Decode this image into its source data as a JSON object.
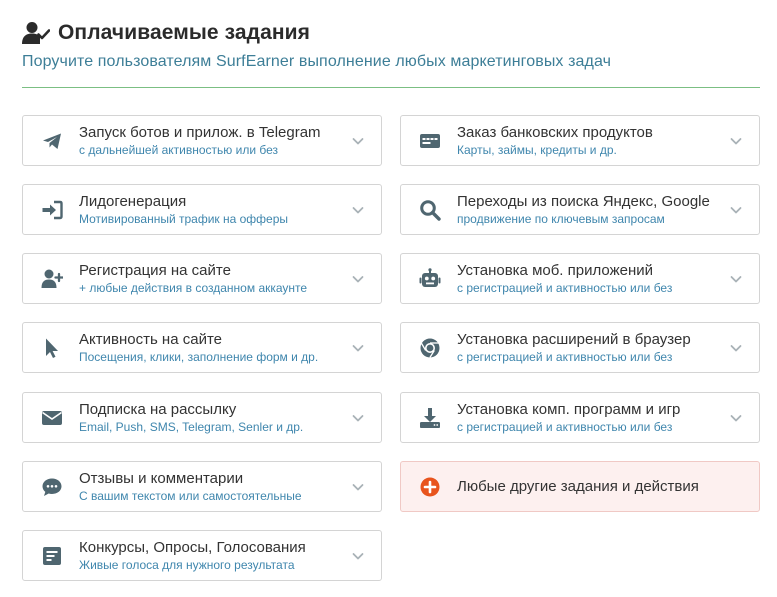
{
  "header": {
    "title": "Оплачиваемые задания",
    "subtitle": "Поручите пользователям SurfEarner выполнение любых маркетинговых задач",
    "icon": "user-check-icon"
  },
  "colors": {
    "accent": "#3f86ad",
    "divider": "#7bbf83",
    "icon_gray": "#4f6670",
    "special_bg": "#fdf0ef",
    "special_icon": "#e8541d"
  },
  "left_column": [
    {
      "title": "Запуск ботов и прилож. в Telegram",
      "subtitle": "с дальнейшей активностью или без",
      "icon": "telegram-icon"
    },
    {
      "title": "Лидогенерация",
      "subtitle": "Мотивированный трафик на офферы",
      "icon": "sign-in-icon"
    },
    {
      "title": "Регистрация на сайте",
      "subtitle": "+ любые действия в созданном аккаунте",
      "icon": "user-plus-icon"
    },
    {
      "title": "Активность на сайте",
      "subtitle": "Посещения, клики, заполнение форм и др.",
      "icon": "cursor-icon"
    },
    {
      "title": "Подписка на рассылку",
      "subtitle": "Email, Push, SMS, Telegram, Senler и др.",
      "icon": "envelope-icon"
    },
    {
      "title": "Отзывы и комментарии",
      "subtitle": "С вашим текстом или самостоятельные",
      "icon": "comment-icon"
    },
    {
      "title": "Конкурсы, Опросы, Голосования",
      "subtitle": "Живые голоса для нужного результата",
      "icon": "poll-icon"
    }
  ],
  "right_column": [
    {
      "title": "Заказ банковских продуктов",
      "subtitle": "Карты, займы, кредиты и др.",
      "icon": "credit-card-icon"
    },
    {
      "title": "Переходы из поиска Яндекс, Google",
      "subtitle": "продвижение по ключевым запросам",
      "icon": "search-icon"
    },
    {
      "title": "Установка моб. приложений",
      "subtitle": "с регистрацией и активностью или без",
      "icon": "robot-icon"
    },
    {
      "title": "Установка расширений в браузер",
      "subtitle": "с регистрацией и активностью или без",
      "icon": "chrome-icon"
    },
    {
      "title": "Установка комп. программ и игр",
      "subtitle": "с регистрацией и активностью или без",
      "icon": "download-icon"
    },
    {
      "title": "Любые другие задания и действия",
      "icon": "plus-circle-icon"
    }
  ]
}
